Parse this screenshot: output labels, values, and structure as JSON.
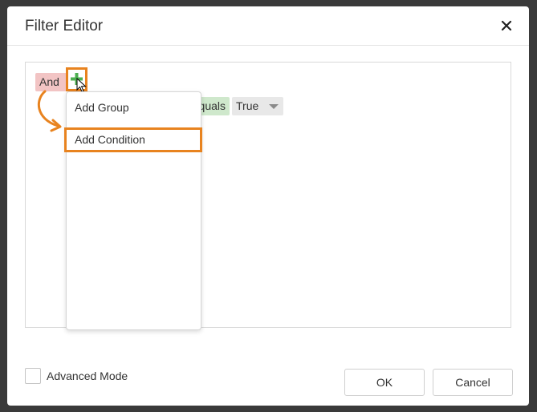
{
  "dialog": {
    "title": "Filter Editor",
    "close_icon": "close-icon"
  },
  "filter": {
    "group_operator": "And",
    "condition_operator": "Equals",
    "condition_operator_visible": "quals",
    "condition_value": "True",
    "add_icon": "plus-icon"
  },
  "menu": {
    "items": [
      {
        "label": "Add Group"
      },
      {
        "label": "Add Condition",
        "highlighted": true
      }
    ]
  },
  "footer": {
    "advanced_mode_label": "Advanced Mode",
    "advanced_mode_checked": false,
    "ok_label": "OK",
    "cancel_label": "Cancel"
  },
  "colors": {
    "highlight": "#e8831f",
    "group_chip": "#f2c4c4",
    "operator_chip": "#cfe8cc",
    "value_chip": "#e8e8e8",
    "plus": "#4caf50"
  }
}
